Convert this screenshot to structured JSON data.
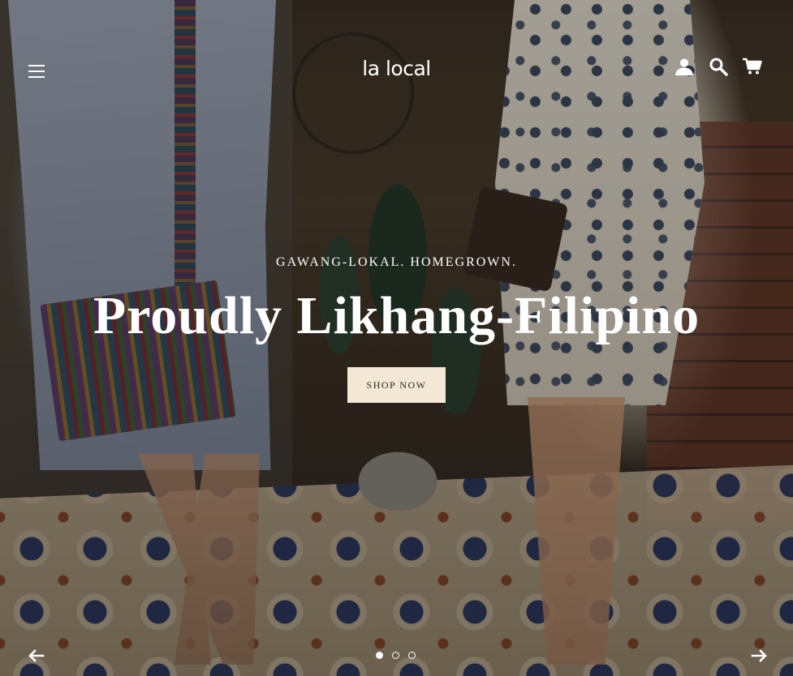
{
  "header": {
    "logo": "la local",
    "menu_icon": "hamburger-menu-icon",
    "icons": [
      "account-icon",
      "search-icon",
      "cart-icon"
    ]
  },
  "hero": {
    "eyebrow": "GAWANG-LOKAL. HOMEGROWN.",
    "headline": "Proudly Likhang-Filipino",
    "cta_label": "SHOP NOW"
  },
  "slideshow": {
    "prev_icon": "arrow-left-icon",
    "next_icon": "arrow-right-icon",
    "slide_count": 3,
    "active_slide": 1
  },
  "colors": {
    "text": "#ffffff",
    "button_bg": "#f3e8d6",
    "button_text": "#2a2520"
  }
}
